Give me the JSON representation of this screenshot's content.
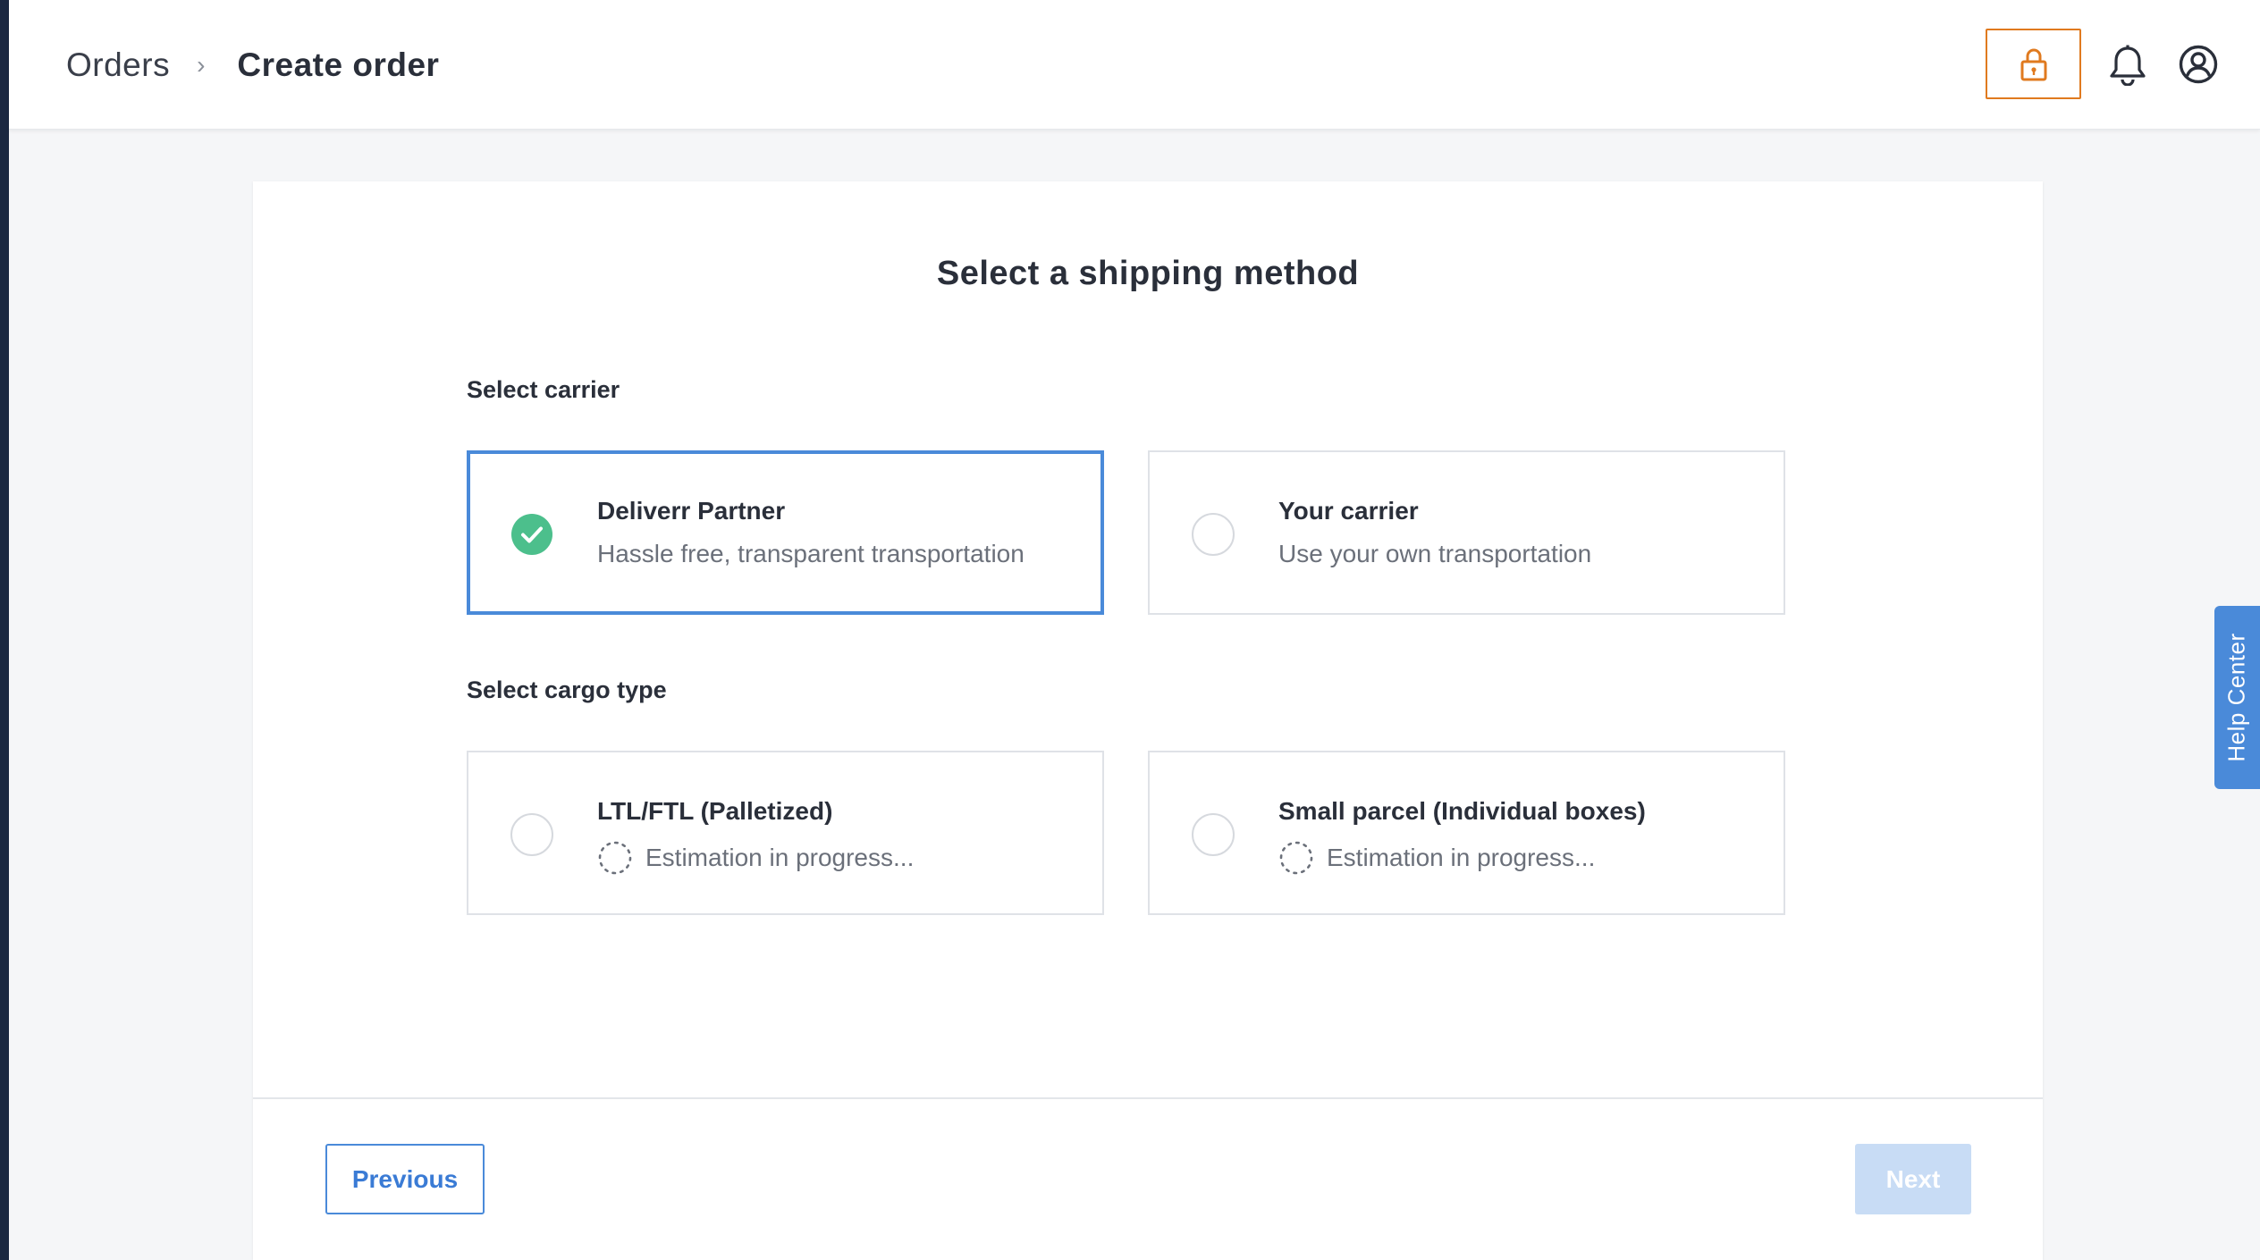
{
  "breadcrumb": {
    "parent": "Orders",
    "separator": "›",
    "current": "Create order"
  },
  "header_icons": [
    "lock-icon",
    "bell-icon",
    "account-icon"
  ],
  "colors": {
    "accent": "#4a8ad9",
    "lock_border": "#e07a1f",
    "success": "#4cbf8c",
    "next_disabled": "#c8dcf5"
  },
  "card": {
    "title": "Select a shipping method",
    "carrier": {
      "label": "Select carrier",
      "options": [
        {
          "title": "Deliverr Partner",
          "description": "Hassle free, transparent transportation",
          "selected": true
        },
        {
          "title": "Your carrier",
          "description": "Use your own transportation",
          "selected": false
        }
      ]
    },
    "cargo": {
      "label": "Select cargo type",
      "options": [
        {
          "title": "LTL/FTL (Palletized)",
          "status": "Estimation in progress...",
          "selected": false
        },
        {
          "title": "Small parcel (Individual boxes)",
          "status": "Estimation in progress...",
          "selected": false
        }
      ]
    }
  },
  "footer": {
    "previous_label": "Previous",
    "next_label": "Next",
    "next_enabled": false
  },
  "help_tab": {
    "label": "Help Center"
  }
}
